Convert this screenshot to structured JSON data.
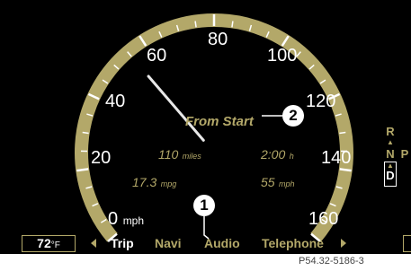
{
  "speedometer": {
    "tick_labels": [
      "0",
      "20",
      "40",
      "60",
      "80",
      "100",
      "120",
      "140",
      "160"
    ],
    "speed_unit": "mph",
    "needle_value_mph": 55
  },
  "trip_display": {
    "title": "From Start",
    "distance_value": "110",
    "distance_unit": "miles",
    "time_value": "2:00",
    "time_unit": "h",
    "economy_value": "17.3",
    "economy_unit": "mpg",
    "avg_speed_value": "55",
    "avg_speed_unit": "mph"
  },
  "callouts": {
    "one": "1",
    "two": "2"
  },
  "gear_indicator": {
    "reverse": "R",
    "neutral": "N",
    "drive": "D",
    "park": "P"
  },
  "temperature": {
    "value": "72",
    "unit": "°F"
  },
  "menu": {
    "items": [
      "Trip",
      "Navi",
      "Audio",
      "Telephone"
    ],
    "active_index": 0
  },
  "caption": "P54.32-5186-3",
  "colors": {
    "accent": "#b3a869",
    "background": "#000000",
    "text": "#ffffff"
  }
}
